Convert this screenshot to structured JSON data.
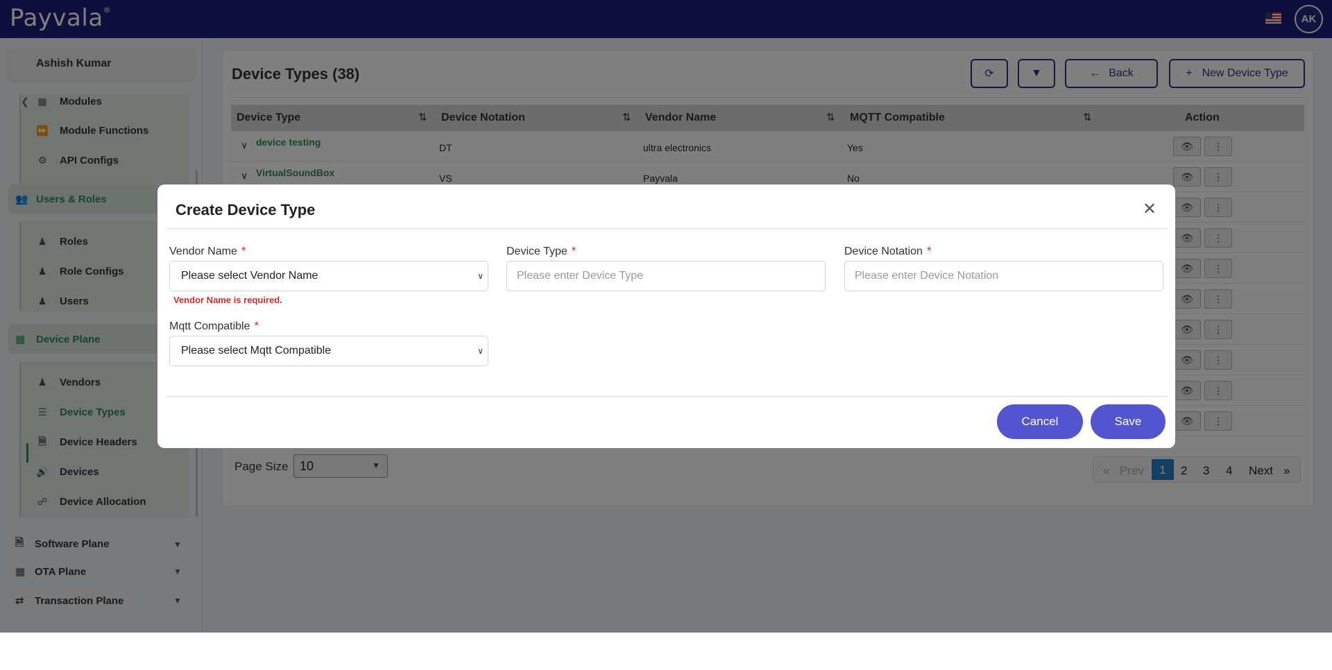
{
  "brand": {
    "logo_text": "Payvala",
    "registered": "®"
  },
  "header": {
    "avatar_initials": "AK"
  },
  "sidebar": {
    "user_name": "Ashish Kumar",
    "admin_items": [
      {
        "label": "Modules",
        "icon": "grid-icon"
      },
      {
        "label": "Module Functions",
        "icon": "fast-forward-icon"
      },
      {
        "label": "API Configs",
        "icon": "api-icon"
      }
    ],
    "users_roles": {
      "title": "Users & Roles",
      "items": [
        {
          "label": "Roles",
          "icon": "user-tie-icon"
        },
        {
          "label": "Role Configs",
          "icon": "user-cog-icon"
        },
        {
          "label": "Users",
          "icon": "users-icon"
        }
      ]
    },
    "device_plane": {
      "title": "Device Plane",
      "items": [
        {
          "label": "Vendors",
          "icon": "users-icon"
        },
        {
          "label": "Device Types",
          "icon": "list-icon"
        },
        {
          "label": "Device Headers",
          "icon": "file-icon"
        },
        {
          "label": "Devices",
          "icon": "speaker-icon"
        },
        {
          "label": "Device Allocation",
          "icon": "sitemap-icon"
        }
      ]
    },
    "collapsed_sections": [
      {
        "label": "Software Plane",
        "icon": "file-icon"
      },
      {
        "label": "OTA Plane",
        "icon": "table-icon"
      },
      {
        "label": "Transaction Plane",
        "icon": "exchange-icon"
      }
    ]
  },
  "page": {
    "title": "Device Types (38)",
    "back_label": "Back",
    "new_label": "New Device Type",
    "columns": [
      "Device Type",
      "Device Notation",
      "Vendor Name",
      "MQTT Compatible",
      "Action"
    ],
    "rows": [
      {
        "type": "device testing",
        "notation": "DT",
        "vendor": "ultra electronics",
        "mqtt": "Yes"
      },
      {
        "type": "VirtualSoundBox",
        "notation": "VS",
        "vendor": "Payvala",
        "mqtt": "No"
      }
    ],
    "page_size_label": "Page Size",
    "page_size_value": "10",
    "pagination": {
      "prev": "Prev",
      "next": "Next",
      "pages": [
        "1",
        "2",
        "3",
        "4"
      ],
      "current": "1",
      "first_glyph": "«",
      "last_glyph": "»"
    }
  },
  "modal": {
    "title": "Create Device Type",
    "fields": {
      "vendor_label": "Vendor Name",
      "vendor_value": "Please select Vendor Name",
      "vendor_error": "Vendor Name is required.",
      "device_type_label": "Device Type",
      "device_type_placeholder": "Please enter Device Type",
      "notation_label": "Device Notation",
      "notation_placeholder": "Please enter Device Notation",
      "mqtt_label": "Mqtt Compatible",
      "mqtt_value": "Please select Mqtt Compatible",
      "required_mark": "*"
    },
    "cancel_label": "Cancel",
    "save_label": "Save"
  },
  "colors": {
    "topbar": "#1c1f7a",
    "accent_green": "#2f8a4f",
    "button_purple": "#5254d0",
    "error_red": "#d42a2a",
    "page_active": "#2680c2"
  }
}
